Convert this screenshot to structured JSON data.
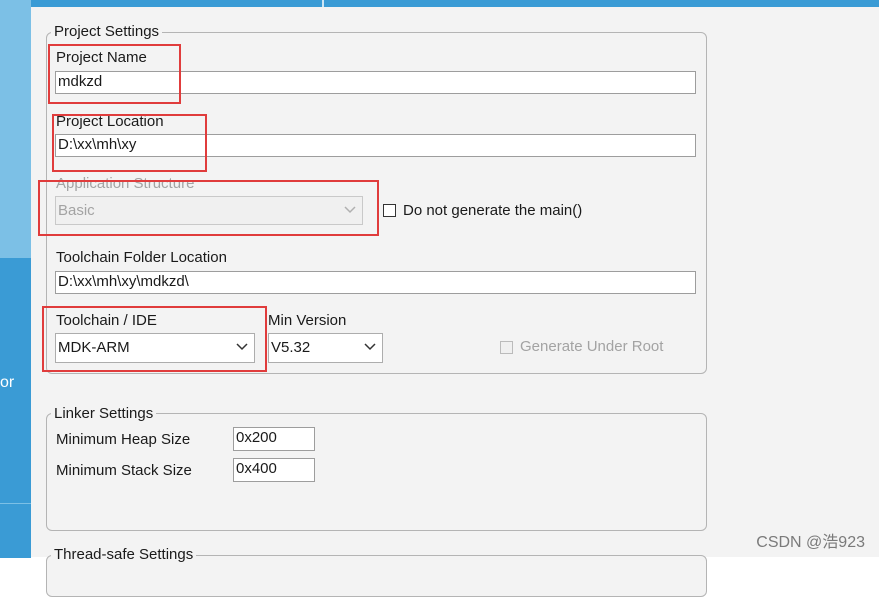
{
  "sidebar": {
    "partial_text": "or"
  },
  "project_settings": {
    "legend": "Project Settings",
    "project_name": {
      "label": "Project Name",
      "value": "mdkzd"
    },
    "project_location": {
      "label": "Project Location",
      "value": "D:\\xx\\mh\\xy"
    },
    "application_structure": {
      "label": "Application Structure",
      "value": "Basic",
      "disabled": true
    },
    "do_not_generate_main": {
      "label": "Do not generate the main()",
      "checked": false
    },
    "toolchain_folder": {
      "label": "Toolchain Folder Location",
      "value": "D:\\xx\\mh\\xy\\mdkzd\\"
    },
    "toolchain_ide": {
      "label": "Toolchain / IDE",
      "value": "MDK-ARM"
    },
    "min_version": {
      "label": "Min Version",
      "value": "V5.32"
    },
    "generate_under_root": {
      "label": "Generate Under Root",
      "checked": false,
      "disabled": true
    }
  },
  "linker_settings": {
    "legend": "Linker Settings",
    "min_heap": {
      "label": "Minimum Heap Size",
      "value": "0x200"
    },
    "min_stack": {
      "label": "Minimum Stack Size",
      "value": "0x400"
    }
  },
  "thread_safe": {
    "legend": "Thread-safe Settings"
  },
  "watermark": "CSDN @浩923",
  "colors": {
    "sidebar": "#3a9bd5",
    "sidebar_light": "#7cc0e6",
    "highlight": "#e03c3c",
    "panel": "#f3f3f3"
  },
  "icons": [
    "chevron-down-icon",
    "checkbox-icon"
  ]
}
